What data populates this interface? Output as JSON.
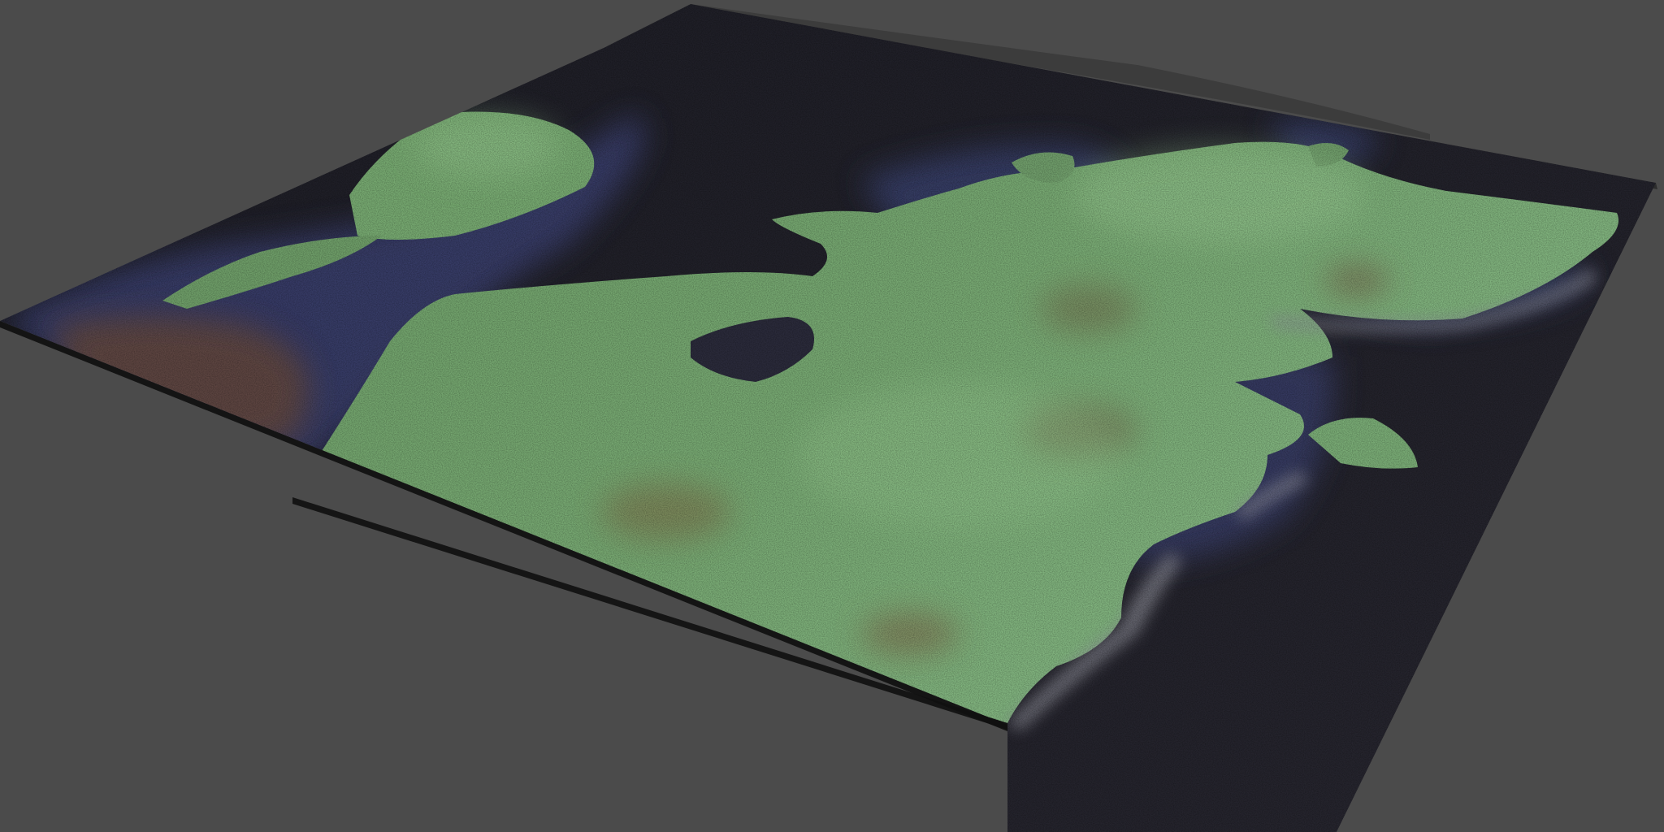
{
  "viewport": {
    "background_color": "#4b4b4b"
  },
  "terrain": {
    "type": "heightmap-terrain",
    "palette": {
      "grass_light": "#7fb07a",
      "grass_mid": "#5f8d5c",
      "grass_dark": "#3f6a40",
      "shore_brown": "#6f4c3a",
      "shallow_water": "#3d4268",
      "deep_water": "#22212b",
      "cliff_gray": "#8e8f99",
      "edge_shadow": "#161616"
    }
  }
}
